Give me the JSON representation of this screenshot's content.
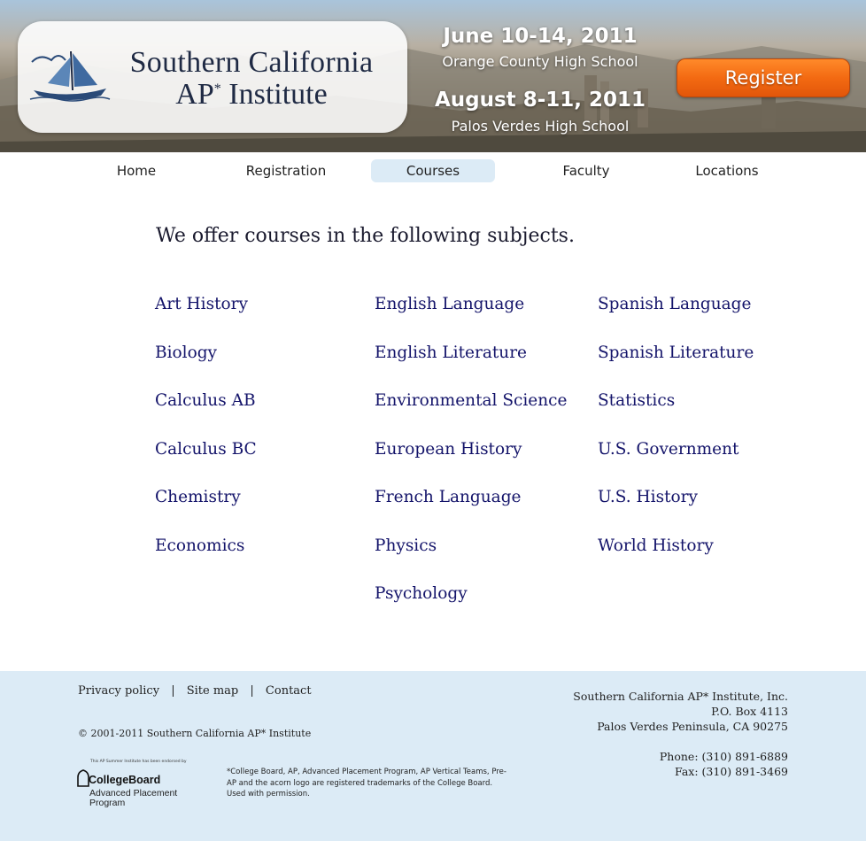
{
  "header": {
    "logo": {
      "line1": "Southern California",
      "line2": "AP",
      "line2_sup": "*",
      "line2_rest": " Institute"
    },
    "events": [
      {
        "date": "June 10-14, 2011",
        "place": "Orange County High School"
      },
      {
        "date": "August 8-11, 2011",
        "place": "Palos Verdes High School"
      }
    ],
    "register_label": "Register"
  },
  "nav": {
    "items": [
      {
        "label": "Home",
        "active": false
      },
      {
        "label": "Registration",
        "active": false
      },
      {
        "label": "Courses",
        "active": true
      },
      {
        "label": "Faculty",
        "active": false
      },
      {
        "label": "Locations",
        "active": false
      }
    ]
  },
  "main": {
    "intro": "We offer courses in the following subjects.",
    "columns": [
      [
        "Art History",
        "Biology",
        "Calculus AB",
        "Calculus BC",
        "Chemistry",
        "Economics"
      ],
      [
        "English Language",
        "English Literature",
        "Environmental Science",
        "European History",
        "French Language",
        "Physics",
        "Psychology"
      ],
      [
        "Spanish Language",
        "Spanish Literature",
        "Statistics",
        "U.S. Government",
        "U.S. History",
        "World History"
      ]
    ]
  },
  "footer": {
    "links": [
      "Privacy policy",
      "Site map",
      "Contact"
    ],
    "separator": "|",
    "copyright": "© 2001-2011 Southern California AP* Institute",
    "address": {
      "org": "Southern California AP* Institute, Inc.",
      "box": "P.O. Box 4113",
      "city": "Palos Verdes Peninsula, CA 90275",
      "phone": "Phone: (310) 891-6889",
      "fax": "Fax: (310) 891-3469"
    },
    "cb_logo": {
      "small": "This AP Summer Institute has been endorsed by",
      "name": "CollegeBoard",
      "sub1": "Advanced Placement",
      "sub2": "Program"
    },
    "trademark": "*College Board, AP, Advanced Placement Program, AP Vertical Teams, Pre-AP and the acorn logo are registered trademarks of the College Board. Used with permission."
  },
  "colors": {
    "accent": "#f36a12",
    "nav_active_bg": "#dcebf6",
    "course_link": "#14146a",
    "footer_bg": "#dcebf6"
  }
}
